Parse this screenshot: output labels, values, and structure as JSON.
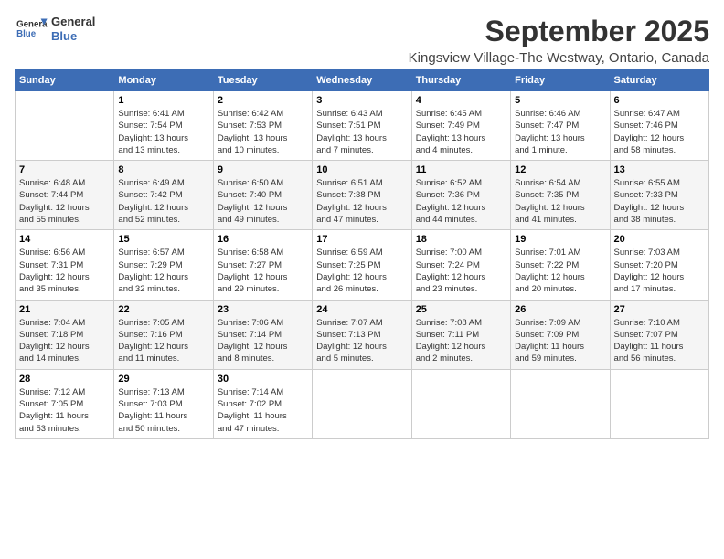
{
  "header": {
    "logo_line1": "General",
    "logo_line2": "Blue",
    "month": "September 2025",
    "location": "Kingsview Village-The Westway, Ontario, Canada"
  },
  "weekdays": [
    "Sunday",
    "Monday",
    "Tuesday",
    "Wednesday",
    "Thursday",
    "Friday",
    "Saturday"
  ],
  "weeks": [
    [
      {
        "day": "",
        "info": ""
      },
      {
        "day": "1",
        "info": "Sunrise: 6:41 AM\nSunset: 7:54 PM\nDaylight: 13 hours\nand 13 minutes."
      },
      {
        "day": "2",
        "info": "Sunrise: 6:42 AM\nSunset: 7:53 PM\nDaylight: 13 hours\nand 10 minutes."
      },
      {
        "day": "3",
        "info": "Sunrise: 6:43 AM\nSunset: 7:51 PM\nDaylight: 13 hours\nand 7 minutes."
      },
      {
        "day": "4",
        "info": "Sunrise: 6:45 AM\nSunset: 7:49 PM\nDaylight: 13 hours\nand 4 minutes."
      },
      {
        "day": "5",
        "info": "Sunrise: 6:46 AM\nSunset: 7:47 PM\nDaylight: 13 hours\nand 1 minute."
      },
      {
        "day": "6",
        "info": "Sunrise: 6:47 AM\nSunset: 7:46 PM\nDaylight: 12 hours\nand 58 minutes."
      }
    ],
    [
      {
        "day": "7",
        "info": "Sunrise: 6:48 AM\nSunset: 7:44 PM\nDaylight: 12 hours\nand 55 minutes."
      },
      {
        "day": "8",
        "info": "Sunrise: 6:49 AM\nSunset: 7:42 PM\nDaylight: 12 hours\nand 52 minutes."
      },
      {
        "day": "9",
        "info": "Sunrise: 6:50 AM\nSunset: 7:40 PM\nDaylight: 12 hours\nand 49 minutes."
      },
      {
        "day": "10",
        "info": "Sunrise: 6:51 AM\nSunset: 7:38 PM\nDaylight: 12 hours\nand 47 minutes."
      },
      {
        "day": "11",
        "info": "Sunrise: 6:52 AM\nSunset: 7:36 PM\nDaylight: 12 hours\nand 44 minutes."
      },
      {
        "day": "12",
        "info": "Sunrise: 6:54 AM\nSunset: 7:35 PM\nDaylight: 12 hours\nand 41 minutes."
      },
      {
        "day": "13",
        "info": "Sunrise: 6:55 AM\nSunset: 7:33 PM\nDaylight: 12 hours\nand 38 minutes."
      }
    ],
    [
      {
        "day": "14",
        "info": "Sunrise: 6:56 AM\nSunset: 7:31 PM\nDaylight: 12 hours\nand 35 minutes."
      },
      {
        "day": "15",
        "info": "Sunrise: 6:57 AM\nSunset: 7:29 PM\nDaylight: 12 hours\nand 32 minutes."
      },
      {
        "day": "16",
        "info": "Sunrise: 6:58 AM\nSunset: 7:27 PM\nDaylight: 12 hours\nand 29 minutes."
      },
      {
        "day": "17",
        "info": "Sunrise: 6:59 AM\nSunset: 7:25 PM\nDaylight: 12 hours\nand 26 minutes."
      },
      {
        "day": "18",
        "info": "Sunrise: 7:00 AM\nSunset: 7:24 PM\nDaylight: 12 hours\nand 23 minutes."
      },
      {
        "day": "19",
        "info": "Sunrise: 7:01 AM\nSunset: 7:22 PM\nDaylight: 12 hours\nand 20 minutes."
      },
      {
        "day": "20",
        "info": "Sunrise: 7:03 AM\nSunset: 7:20 PM\nDaylight: 12 hours\nand 17 minutes."
      }
    ],
    [
      {
        "day": "21",
        "info": "Sunrise: 7:04 AM\nSunset: 7:18 PM\nDaylight: 12 hours\nand 14 minutes."
      },
      {
        "day": "22",
        "info": "Sunrise: 7:05 AM\nSunset: 7:16 PM\nDaylight: 12 hours\nand 11 minutes."
      },
      {
        "day": "23",
        "info": "Sunrise: 7:06 AM\nSunset: 7:14 PM\nDaylight: 12 hours\nand 8 minutes."
      },
      {
        "day": "24",
        "info": "Sunrise: 7:07 AM\nSunset: 7:13 PM\nDaylight: 12 hours\nand 5 minutes."
      },
      {
        "day": "25",
        "info": "Sunrise: 7:08 AM\nSunset: 7:11 PM\nDaylight: 12 hours\nand 2 minutes."
      },
      {
        "day": "26",
        "info": "Sunrise: 7:09 AM\nSunset: 7:09 PM\nDaylight: 11 hours\nand 59 minutes."
      },
      {
        "day": "27",
        "info": "Sunrise: 7:10 AM\nSunset: 7:07 PM\nDaylight: 11 hours\nand 56 minutes."
      }
    ],
    [
      {
        "day": "28",
        "info": "Sunrise: 7:12 AM\nSunset: 7:05 PM\nDaylight: 11 hours\nand 53 minutes."
      },
      {
        "day": "29",
        "info": "Sunrise: 7:13 AM\nSunset: 7:03 PM\nDaylight: 11 hours\nand 50 minutes."
      },
      {
        "day": "30",
        "info": "Sunrise: 7:14 AM\nSunset: 7:02 PM\nDaylight: 11 hours\nand 47 minutes."
      },
      {
        "day": "",
        "info": ""
      },
      {
        "day": "",
        "info": ""
      },
      {
        "day": "",
        "info": ""
      },
      {
        "day": "",
        "info": ""
      }
    ]
  ]
}
